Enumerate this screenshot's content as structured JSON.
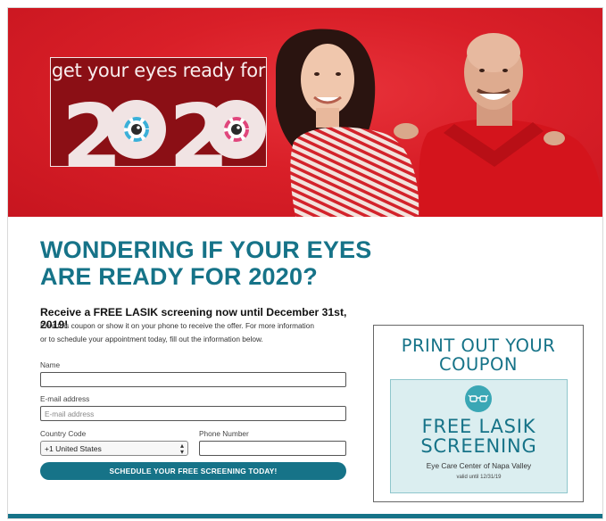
{
  "hero": {
    "tagline": "get your eyes ready for",
    "year_digit_left": "2",
    "year_digit_right": "2",
    "brand_red": "#d91f28",
    "logo_bg": "#8b0f15"
  },
  "main": {
    "headline_line1": "WONDERING IF YOUR EYES",
    "headline_line2": "ARE READY FOR 2020?",
    "subhead": "Receive a FREE LASIK screening now until December 31st, 2019!",
    "body_line1": "Print this coupon or show it on your phone to receive the offer. For more information",
    "body_line2": "or to schedule your appointment today, fill out the information below."
  },
  "form": {
    "name_label": "Name",
    "name_value": "",
    "email_label": "E-mail address",
    "email_placeholder": "E-mail address",
    "country_label": "Country Code",
    "country_value": "+1 United States",
    "phone_label": "Phone Number",
    "phone_value": "",
    "submit_label": "SCHEDULE YOUR FREE SCREENING TODAY!"
  },
  "coupon": {
    "heading_line1": "PRINT OUT YOUR",
    "heading_line2": "COUPON",
    "icon": "glasses-icon",
    "offer_line1": "FREE LASIK",
    "offer_line2": "SCREENING",
    "center_name": "Eye Care Center of Napa Valley",
    "valid_text": "valid until 12/31/19"
  },
  "colors": {
    "accent_teal": "#167388",
    "coupon_bg": "#dbeef0"
  }
}
